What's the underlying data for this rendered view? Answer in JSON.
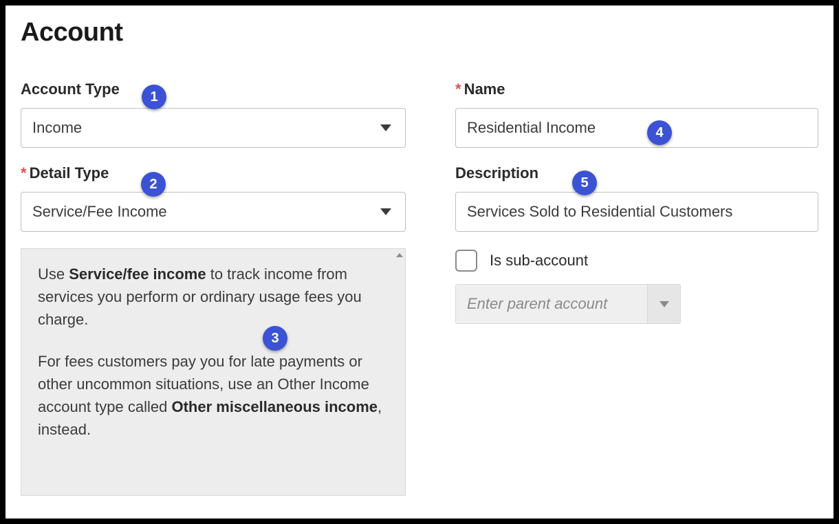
{
  "title": "Account",
  "left": {
    "accountType": {
      "label": "Account Type",
      "value": "Income"
    },
    "detailType": {
      "label": "Detail Type",
      "required": true,
      "value": "Service/Fee Income"
    },
    "help": {
      "p1_pre": "Use ",
      "p1_bold": "Service/fee income",
      "p1_post": " to track income from services you perform or ordinary usage fees you charge.",
      "p2_pre": "For fees customers pay you for late payments or other uncommon situations, use an Other Income account type called ",
      "p2_bold": "Other miscellaneous income",
      "p2_post": ", instead."
    }
  },
  "right": {
    "name": {
      "label": "Name",
      "required": true,
      "value": "Residential Income"
    },
    "description": {
      "label": "Description",
      "value": "Services Sold to Residential Customers"
    },
    "subAccount": {
      "label": "Is sub-account",
      "checked": false,
      "parentPlaceholder": "Enter parent account"
    }
  },
  "annotations": {
    "b1": "1",
    "b2": "2",
    "b3": "3",
    "b4": "4",
    "b5": "5"
  }
}
